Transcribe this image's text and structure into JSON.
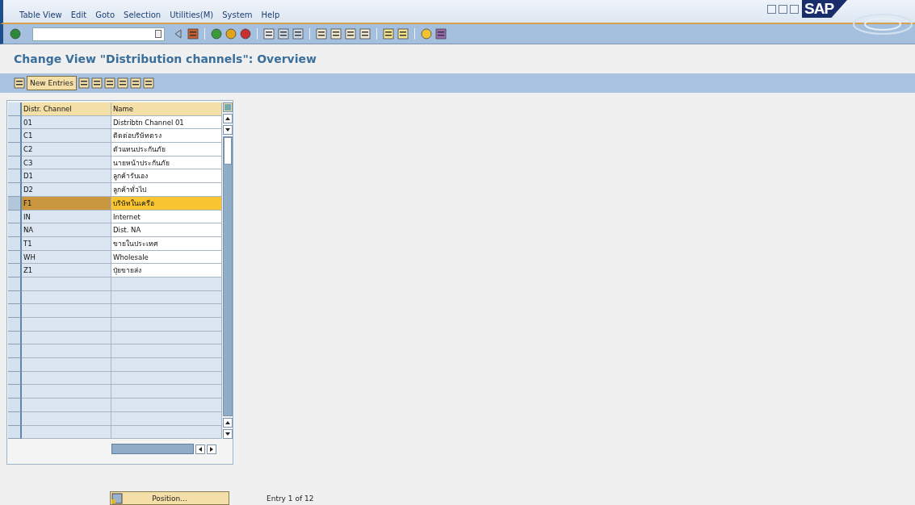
{
  "menu_bar": {
    "items": [
      "Table View",
      "Edit",
      "Goto",
      "Selection",
      "Utilities(M)",
      "System",
      "Help"
    ],
    "logo": "SAP"
  },
  "title": "Change View \"Distribution channels\": Overview",
  "app_toolbar": {
    "button": "New Entries"
  },
  "table": {
    "columns": [
      "Distr. Channel",
      "Name"
    ],
    "rows": [
      {
        "code": "01",
        "name": "Distribtn Channel 01",
        "selected": false
      },
      {
        "code": "C1",
        "name": "ติดต่อบริษัทตรง",
        "selected": false
      },
      {
        "code": "C2",
        "name": "ตัวแทนประกันภัย",
        "selected": false
      },
      {
        "code": "C3",
        "name": "นายหน้าประกันภัย",
        "selected": false
      },
      {
        "code": "D1",
        "name": "ลูกค้ารับเอง",
        "selected": false
      },
      {
        "code": "D2",
        "name": "ลูกค้าทั่วไป",
        "selected": false
      },
      {
        "code": "F1",
        "name": "บริษัทในเครือ",
        "selected": true
      },
      {
        "code": "IN",
        "name": "Internet",
        "selected": false
      },
      {
        "code": "NA",
        "name": "Dist. NA",
        "selected": false
      },
      {
        "code": "T1",
        "name": "ขายในประเทศ",
        "selected": false
      },
      {
        "code": "WH",
        "name": "Wholesale",
        "selected": false
      },
      {
        "code": "Z1",
        "name": "ปุ๋ยขายส่ง",
        "selected": false
      }
    ]
  },
  "footer": {
    "position_button": "Position...",
    "entry_info": "Entry 1 of 12"
  }
}
